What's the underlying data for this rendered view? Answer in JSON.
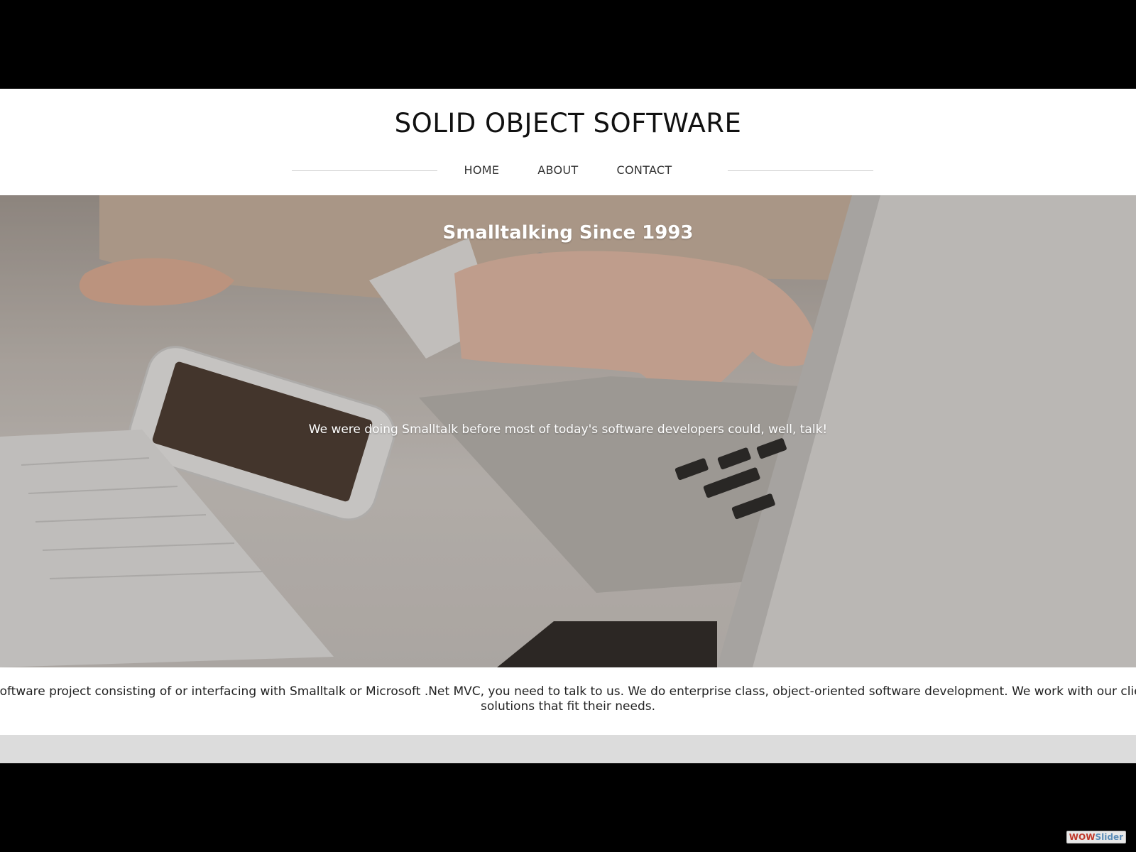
{
  "header": {
    "site_title": "SOLID OBJECT SOFTWARE",
    "nav": [
      {
        "label": "HOME"
      },
      {
        "label": "ABOUT"
      },
      {
        "label": "CONTACT"
      }
    ]
  },
  "hero": {
    "title": "Smalltalking Since 1993",
    "subtitle": "We were doing Smalltalk before most of today's software developers could, well, talk!"
  },
  "intro": {
    "line1": "a software project consisting of or interfacing with Smalltalk or Microsoft .Net MVC, you need to talk to us. We do enterprise class, object-oriented software development. We work with our client",
    "line2": "solutions that fit their needs."
  },
  "badge": {
    "part1": "WOW",
    "part2": "Slider"
  },
  "colors": {
    "page_bg": "#000000",
    "header_bg": "#ffffff",
    "strip_gray": "#dcdcdc"
  }
}
